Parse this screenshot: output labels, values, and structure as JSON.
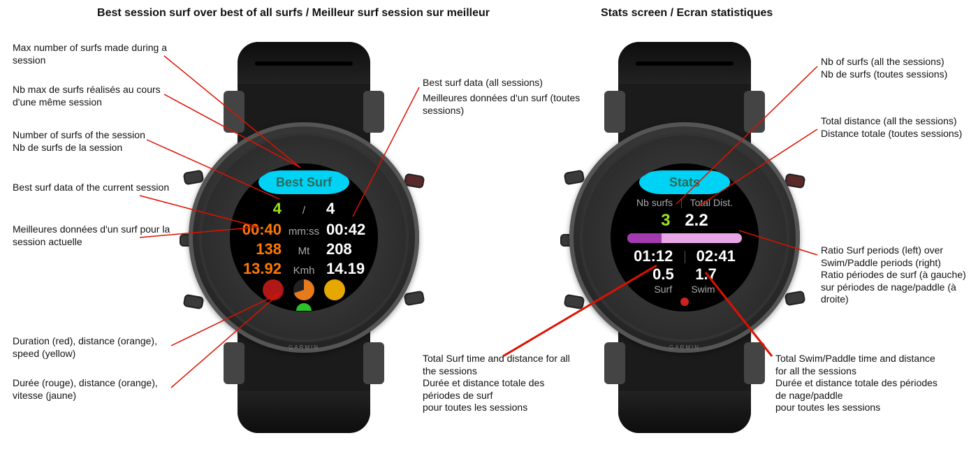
{
  "titles": {
    "left": "Best session surf over best of all surfs / Meilleur surf session sur meilleur",
    "right": "Stats screen / Ecran statistiques"
  },
  "brand": "GARMIN",
  "left_face": {
    "pill": "Best Surf",
    "row1": {
      "session": "4",
      "sep": "/",
      "all": "4"
    },
    "row2": {
      "session": "00:40",
      "unit": "mm:ss",
      "all": "00:42"
    },
    "row3": {
      "session": "138",
      "unit": "Mt",
      "all": "208"
    },
    "row4": {
      "session": "13.92",
      "unit": "Kmh",
      "all": "14.19"
    },
    "colors": {
      "row1L": "#9be51c",
      "row1R": "#ffffff",
      "row2L": "#ff7a00",
      "row3L": "#ff7a00",
      "row4L": "#ff7a00"
    }
  },
  "right_face": {
    "pill": "Stats",
    "h": {
      "left": "Nb surfs",
      "right": "Total Dist."
    },
    "v": {
      "left": "3",
      "right": "2.2"
    },
    "ratio_pct": 30,
    "t": {
      "left": "01:12",
      "right": "02:41"
    },
    "d": {
      "left": "0.5",
      "right": "1.7"
    },
    "lbl": {
      "left": "Surf",
      "right": "Swim"
    }
  },
  "notes": {
    "nL1a": "Max number of surfs made during a session",
    "nL1b": "Nb max de surfs réalisés au cours d'une même session",
    "nL2": "Number of surfs of the session\nNb de surfs de la session",
    "nL3a": "Best surf data of the current session",
    "nL3b": "Meilleures données d'un surf pour la session actuelle",
    "nL4": "Duration (red), distance (orange), speed (yellow)",
    "nL5": "Durée (rouge), distance (orange), vitesse (jaune)",
    "nLRa": "Best surf data (all sessions)",
    "nLRb": "Meilleures données d'un surf (toutes sessions)",
    "nR1": "Nb of surfs (all the sessions)\nNb de surfs (toutes sessions)",
    "nR2": "Total distance (all the sessions)\nDistance totale (toutes sessions)",
    "nR3": "Ratio Surf periods (left) over Swim/Paddle periods (right)\nRatio périodes de surf (à gauche) sur périodes de nage/paddle (à droite)",
    "nRBL": "Total Surf time and distance for all the sessions\nDurée et distance totale des périodes de surf\npour toutes les sessions",
    "nRBR": "Total Swim/Paddle time and distance for all the sessions\nDurée et distance totale des périodes de nage/paddle\npour toutes les sessions"
  }
}
